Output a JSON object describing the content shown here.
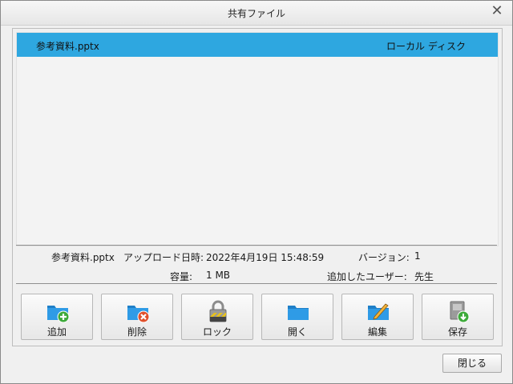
{
  "window": {
    "title": "共有ファイル",
    "close_glyph": "✕"
  },
  "file_list": {
    "rows": [
      {
        "name": "参考資料.pptx",
        "location": "ローカル ディスク",
        "selected": true
      }
    ]
  },
  "details": {
    "file_name": "参考資料.pptx",
    "upload_label": "アップロード日時:",
    "upload_value": "2022年4月19日 15:48:59",
    "version_label": "バージョン:",
    "version_value": "1",
    "size_label": "容量:",
    "size_value": "1 MB",
    "added_by_label": "追加したユーザー:",
    "added_by_value": "先生"
  },
  "toolbar": {
    "add": "追加",
    "delete": "削除",
    "lock": "ロック",
    "open": "開く",
    "edit": "編集",
    "save": "保存"
  },
  "footer": {
    "close_label": "閉じる"
  },
  "colors": {
    "selection": "#2ea7e0",
    "folder": "#2a8fd8"
  }
}
